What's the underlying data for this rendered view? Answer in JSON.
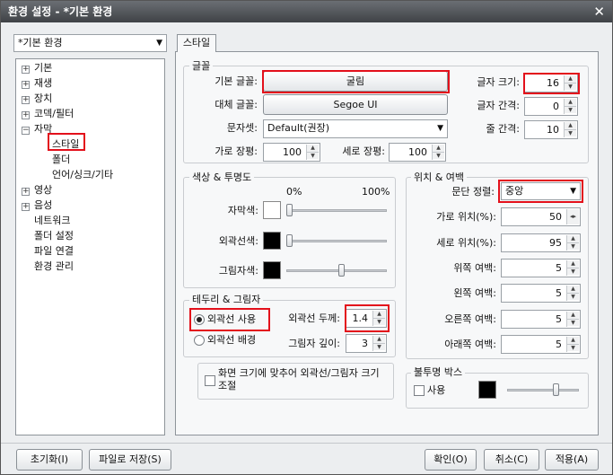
{
  "window": {
    "title": "환경 설정 - *기본 환경",
    "close_glyph": "✕"
  },
  "profile_select": {
    "value": "*기본 환경"
  },
  "tree": {
    "items": [
      {
        "label": "기본",
        "expander": "+"
      },
      {
        "label": "재생",
        "expander": "+"
      },
      {
        "label": "장치",
        "expander": "+"
      },
      {
        "label": "코덱/필터",
        "expander": "+"
      },
      {
        "label": "자막",
        "expander": "−"
      },
      {
        "label": "스타일"
      },
      {
        "label": "폴더"
      },
      {
        "label": "언어/싱크/기타"
      },
      {
        "label": "영상",
        "expander": "+"
      },
      {
        "label": "음성",
        "expander": "+"
      },
      {
        "label": "네트워크"
      },
      {
        "label": "폴더 설정"
      },
      {
        "label": "파일 연결"
      },
      {
        "label": "환경 관리"
      }
    ]
  },
  "tab": {
    "label": "스타일"
  },
  "font_group": {
    "title": "글꼴",
    "base_font_label": "기본 글꼴:",
    "base_font_value": "굴림",
    "alt_font_label": "대체 글꼴:",
    "alt_font_value": "Segoe UI",
    "charset_label": "문자셋:",
    "charset_value": "Default(권장)",
    "hscale_label": "가로 장평:",
    "hscale_value": "100",
    "vscale_label": "세로 장평:",
    "vscale_value": "100",
    "size_label": "글자 크기:",
    "size_value": "16",
    "spacing_label": "글자 간격:",
    "spacing_value": "0",
    "line_spacing_label": "줄 간격:",
    "line_spacing_value": "10"
  },
  "color_group": {
    "title": "색상 & 투명도",
    "pct_min": "0%",
    "pct_max": "100%",
    "subtitle_color_label": "자막색:",
    "outline_color_label": "외곽선색:",
    "shadow_color_label": "그림자색:",
    "subtitle_color": "#ffffff",
    "outline_color": "#000000",
    "shadow_color": "#000000",
    "subtitle_opacity_pct": 0,
    "outline_opacity_pct": 0,
    "shadow_opacity_pct": 55
  },
  "border_group": {
    "title": "테두리 & 그림자",
    "use_outline_label": "외곽선 사용",
    "outline_bg_label": "외곽선 배경",
    "outline_width_label": "외곽선 두께:",
    "outline_width_value": "1.4",
    "shadow_depth_label": "그림자 깊이:",
    "shadow_depth_value": "3"
  },
  "fit_checkbox": {
    "label": "화면 크기에 맞추어 외곽선/그림자 크기 조절"
  },
  "position_group": {
    "title": "위치 & 여백",
    "align_label": "문단 정렬:",
    "align_value": "중앙",
    "hpos_label": "가로 위치(%):",
    "hpos_value": "50",
    "vpos_label": "세로 위치(%):",
    "vpos_value": "95",
    "top_margin_label": "위쪽 여백:",
    "top_margin_value": "5",
    "left_margin_label": "왼쪽 여백:",
    "left_margin_value": "5",
    "right_margin_label": "오른쪽 여백:",
    "right_margin_value": "5",
    "bottom_margin_label": "아래쪽 여백:",
    "bottom_margin_value": "5"
  },
  "opaque_group": {
    "title": "불투명 박스",
    "use_label": "사용",
    "box_color": "#000000",
    "opacity_pct": 70
  },
  "footer": {
    "reset_label": "초기화(I)",
    "save_file_label": "파일로 저장(S)",
    "ok_label": "확인(O)",
    "cancel_label": "취소(C)",
    "apply_label": "적용(A)"
  },
  "colors": {
    "highlight": "#e3101b"
  }
}
